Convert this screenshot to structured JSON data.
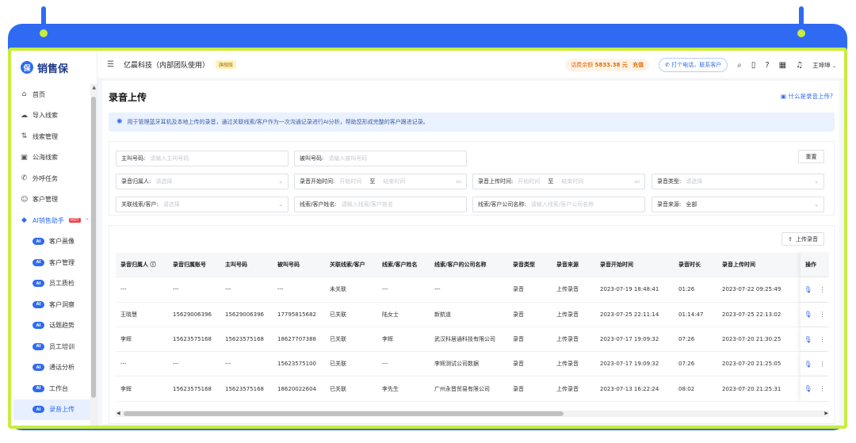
{
  "brand": {
    "name": "销售保",
    "logo_icon": "brand-logo-icon"
  },
  "sidebar": {
    "items": [
      {
        "label": "首页",
        "icon": "home-icon"
      },
      {
        "label": "导入线索",
        "icon": "cloud-upload-icon"
      },
      {
        "label": "线索管理",
        "icon": "sort-icon"
      },
      {
        "label": "公海线索",
        "icon": "document-icon"
      },
      {
        "label": "外呼任务",
        "icon": "phone-icon"
      },
      {
        "label": "客户管理",
        "icon": "user-icon"
      }
    ],
    "ai_group": {
      "label": "AI销售助手",
      "badge": "HOT"
    },
    "ai_badge": "AI",
    "sub_items": [
      "客户画像",
      "客户管理",
      "员工质检",
      "客户洞察",
      "话题趋势",
      "员工培训",
      "通话分析",
      "工作台",
      "录音上传"
    ],
    "active_sub": "录音上传"
  },
  "header": {
    "company": "亿晨科技（内部团队使用）",
    "version_badge": "旗舰版",
    "balance_label": "话费余额",
    "balance_value": "5833.38 元",
    "recharge_label": "充值",
    "call_button": "打个电话，联系客户",
    "user": "王坤坤"
  },
  "page": {
    "title": "录音上传",
    "help_link": "什么是录音上传?",
    "notice": "用于管理蓝牙耳机及本地上传的录音，通过关联线索/客户作为一次沟通记录进行AI分析，帮助您形成完整的客户跟进记录。"
  },
  "filters": {
    "caller": {
      "label": "主叫号码:",
      "placeholder": "请输入主叫号码"
    },
    "callee": {
      "label": "被叫号码:",
      "placeholder": "请输入被叫号码"
    },
    "owner": {
      "label": "录音归属人:",
      "placeholder": "请选择"
    },
    "start_time": {
      "label": "录音开始时间:",
      "start_placeholder": "开始时间",
      "sep": "至",
      "end_placeholder": "结束时间"
    },
    "upload_time": {
      "label": "录音上传时间:",
      "start_placeholder": "开始时间",
      "sep": "至",
      "end_placeholder": "结束时间"
    },
    "type": {
      "label": "录音类型:",
      "placeholder": "请选择"
    },
    "linked": {
      "label": "关联线索/客户:",
      "placeholder": "请选择"
    },
    "name": {
      "label": "线索/客户姓名:",
      "placeholder": "请输入线索/客户姓名"
    },
    "company": {
      "label": "线索/客户公司名称:",
      "placeholder": "请输入线索/客户公司名称"
    },
    "source": {
      "label": "录音来源:",
      "value": "全部"
    },
    "reset": "重置"
  },
  "table": {
    "upload_button": "上传录音",
    "columns": [
      "录音归属人",
      "录音归属账号",
      "主叫号码",
      "被叫号码",
      "关联线索/客户",
      "线索/客户姓名",
      "线索/客户的公司名称",
      "录音类型",
      "录音来源",
      "录音开始时间",
      "录音时长",
      "录音上传时间",
      "操作"
    ],
    "rows": [
      [
        "---",
        "---",
        "---",
        "---",
        "未关联",
        "---",
        "---",
        "录音",
        "上传录音",
        "2023-07-19 18:48:41",
        "01:26",
        "2023-07-22 09:25:49"
      ],
      [
        "王晓慧",
        "15629006396",
        "15629006396",
        "17795815682",
        "已关联",
        "陆女士",
        "新航道",
        "录音",
        "上传录音",
        "2023-07-25 22:11:14",
        "01:14:47",
        "2023-07-25 22:13:02"
      ],
      [
        "李辉",
        "15623575168",
        "15623575168",
        "18627707388",
        "已关联",
        "李辉",
        "武汉科居通科技有限公司",
        "录音",
        "上传录音",
        "2023-07-17 19:09:32",
        "07:26",
        "2023-07-20 21:30:25"
      ],
      [
        "---",
        "---",
        "---",
        "15623575100",
        "已关联",
        "---",
        "李辉测试公司数据",
        "录音",
        "上传录音",
        "2023-07-17 19:09:32",
        "07:26",
        "2023-07-20 21:25:05"
      ],
      [
        "李辉",
        "15623575168",
        "15623575168",
        "18620022604",
        "已关联",
        "李先生",
        "广州永晋贸易有限公司",
        "录音",
        "上传录音",
        "2023-07-13 16:22:24",
        "08:02",
        "2023-07-20 21:25:31"
      ]
    ]
  },
  "colors": {
    "accent": "#2f6bf2",
    "frame_blue": "#2f6bf2",
    "frame_green": "#c9ec3e",
    "balance": "#e66b00"
  }
}
